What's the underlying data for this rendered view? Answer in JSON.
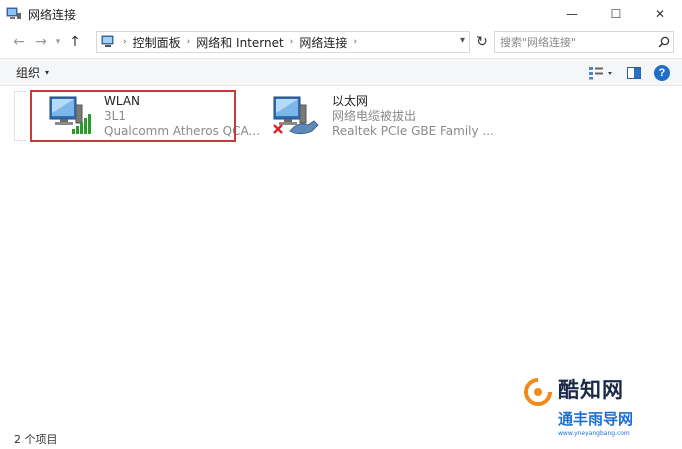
{
  "window": {
    "title": "网络连接",
    "controls": {
      "minimize": "—",
      "maximize": "☐",
      "close": "✕"
    }
  },
  "nav": {
    "back_icon": "←",
    "forward_icon": "→",
    "recent_icon": "▾",
    "up_icon": "↑",
    "breadcrumb": [
      "控制面板",
      "网络和 Internet",
      "网络连接"
    ],
    "separator": "›",
    "dropdown_icon": "▾",
    "refresh_icon": "↻"
  },
  "search": {
    "placeholder": "搜索\"网络连接\""
  },
  "toolbar": {
    "organize_label": "组织",
    "organize_caret": "▾"
  },
  "connections": [
    {
      "name": "WLAN",
      "status": "3L1",
      "device": "Qualcomm Atheros QCA...",
      "icon": "wifi-adapter-icon"
    },
    {
      "name": "以太网",
      "status": "网络电缆被拔出",
      "device": "Realtek PCIe GBE Family ...",
      "icon": "ethernet-adapter-icon"
    }
  ],
  "status_bar": {
    "item_count": "2 个项目"
  },
  "watermark": {
    "brand_top": "酷知网",
    "brand_bottom": "通丰雨导网",
    "url": "www.yneyangbang.com"
  },
  "colors": {
    "highlight": "#c83a3a",
    "help": "#1f6fc8",
    "signal": "#2e9a2e"
  }
}
